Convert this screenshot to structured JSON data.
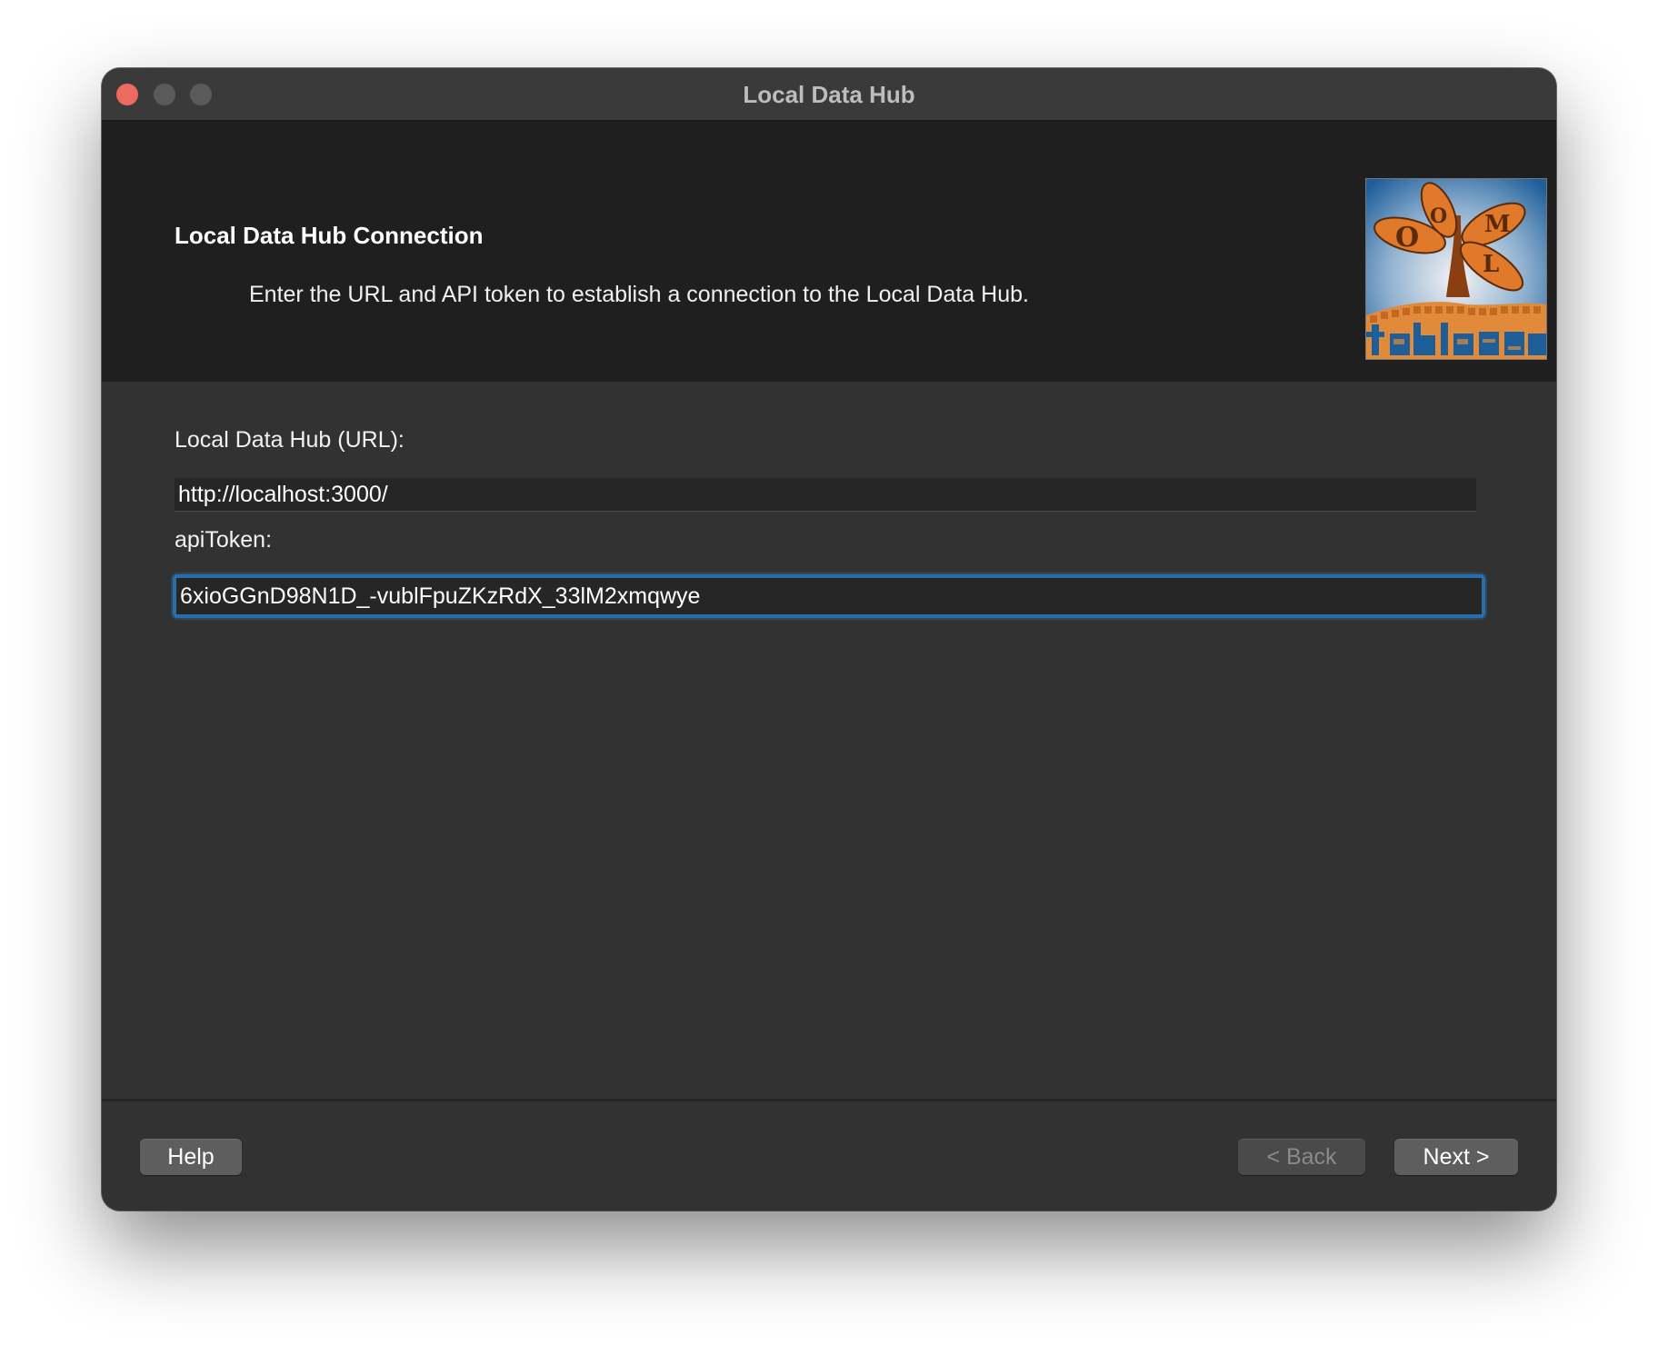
{
  "window": {
    "title": "Local Data Hub"
  },
  "banner": {
    "title": "Local Data Hub Connection",
    "description": "Enter the URL and API token to establish a connection to the Local Data Hub."
  },
  "form": {
    "url_label": "Local Data Hub (URL):",
    "url_value": "http://localhost:3000/",
    "token_label": "apiToken:",
    "token_value": "6xioGGnD98N1D_-vublFpuZKzRdX_33lM2xmqwye"
  },
  "buttons": {
    "help": "Help",
    "back": "< Back",
    "next": "Next >"
  },
  "logo": {
    "icon": "oml-tables-logo"
  },
  "colors": {
    "focus_ring": "#2a6ea8",
    "close_button": "#ec6a5f"
  }
}
